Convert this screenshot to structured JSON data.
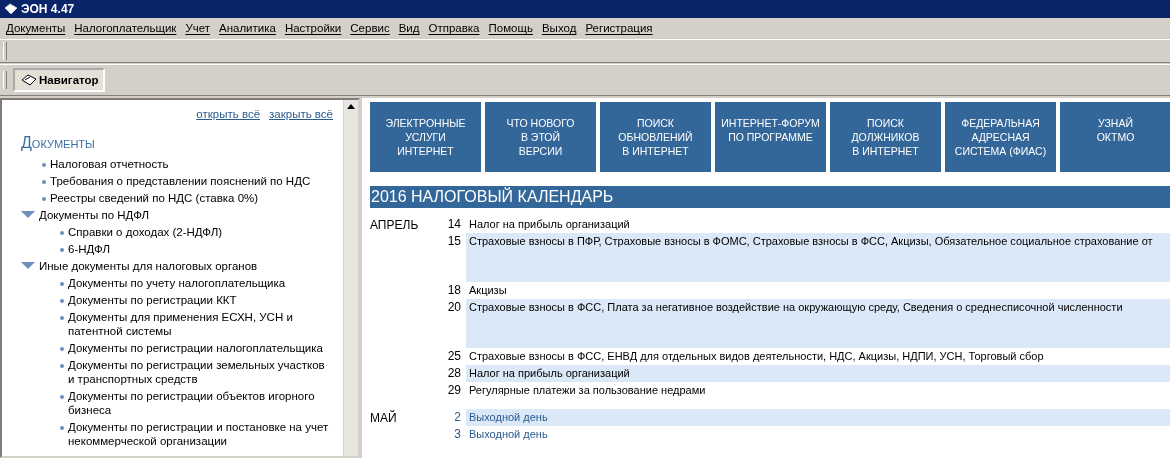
{
  "window": {
    "title": "ЭОН 4.47"
  },
  "menu": [
    "Документы",
    "Налогоплательщик",
    "Учет",
    "Аналитика",
    "Настройки",
    "Сервис",
    "Вид",
    "Отправка",
    "Помощь",
    "Выход",
    "Регистрация"
  ],
  "navigator_tab": {
    "label": "Навигатор",
    "selected": true
  },
  "sidebar": {
    "links": [
      "открыть всё",
      "закрыть всё"
    ],
    "heading": "Документы",
    "items": [
      {
        "label": "Налоговая отчетность"
      },
      {
        "label": "Требования о представлении пояснений по НДС"
      },
      {
        "label": "Реестры сведений по НДС (ставка 0%)"
      },
      {
        "label": "Документы по НДФЛ",
        "expanded": true,
        "children": [
          {
            "label": "Справки о доходах (2-НДФЛ)"
          },
          {
            "label": "6-НДФЛ"
          }
        ]
      },
      {
        "label": "Иные документы для налоговых органов",
        "expanded": true,
        "children": [
          {
            "label": "Документы по учету налогоплательщика"
          },
          {
            "label": "Документы по регистрации ККТ"
          },
          {
            "label": "Документы для применения ЕСХН, УСН и патентной системы"
          },
          {
            "label": "Документы по регистрации налогоплательщика"
          },
          {
            "label": "Документы по регистрации земельных участков и транспортных средств"
          },
          {
            "label": "Документы по регистрации объектов игорного бизнеса"
          },
          {
            "label": "Документы по регистрации и постановке на учет некоммерческой организации"
          }
        ]
      }
    ]
  },
  "tiles": [
    "ЭЛЕКТРОННЫЕ\nУСЛУГИ\nИНТЕРНЕТ",
    "ЧТО НОВОГО\nВ ЭТОЙ\nВЕРСИИ",
    "ПОИСК\nОБНОВЛЕНИЙ\nВ ИНТЕРНЕТ",
    "ИНТЕРНЕТ-ФОРУМ\nПО ПРОГРАММЕ",
    "ПОИСК\nДОЛЖНИКОВ\nВ ИНТЕРНЕТ",
    "ФЕДЕРАЛЬНАЯ\nАДРЕСНАЯ\nСИСТЕМА (ФИАС)",
    "УЗНАЙ\nОКТМО"
  ],
  "calendar": {
    "title": "2016  НАЛОГОВЫЙ КАЛЕНДАРЬ",
    "months": [
      {
        "name": "АПРЕЛЬ",
        "days": [
          {
            "day": "14",
            "text": "Налог на прибыль организаций",
            "kind": "tax",
            "highlighted": false,
            "tall": false
          },
          {
            "day": "15",
            "text": "Страховые взносы в ПФР, Страховые взносы в ФОМС, Страховые взносы в ФСС, Акцизы, Обязательное социальное страхование от",
            "kind": "tax",
            "highlighted": true,
            "tall": true
          },
          {
            "day": "18",
            "text": "Акцизы",
            "kind": "tax",
            "highlighted": false,
            "tall": false
          },
          {
            "day": "20",
            "text": "Страховые взносы в ФСС, Плата за негативное воздействие на окружающую среду, Сведения о среднесписочной численности",
            "kind": "tax",
            "highlighted": true,
            "tall": true
          },
          {
            "day": "25",
            "text": "Страховые взносы в ФСС, ЕНВД для отдельных видов деятельности, НДС, Акцизы, НДПИ, УСН, Торговый сбор",
            "kind": "tax",
            "highlighted": false,
            "tall": false
          },
          {
            "day": "28",
            "text": "Налог на прибыль организаций",
            "kind": "tax",
            "highlighted": true,
            "tall": false
          },
          {
            "day": "29",
            "text": "Регулярные платежи за пользование недрами",
            "kind": "tax",
            "highlighted": false,
            "tall": false
          }
        ]
      },
      {
        "name": "МАЙ",
        "days": [
          {
            "day": "2",
            "text": "Выходной день",
            "kind": "holiday",
            "highlighted": true,
            "tall": false
          },
          {
            "day": "3",
            "text": "Выходной день",
            "kind": "holiday",
            "highlighted": false,
            "tall": false
          }
        ]
      }
    ]
  }
}
